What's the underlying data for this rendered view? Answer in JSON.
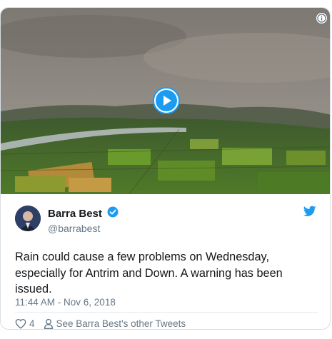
{
  "tweet": {
    "display_name": "Barra Best",
    "handle": "@barrabest",
    "text": "Rain could cause a few problems on Wednesday, especially for Antrim and Down.  A warning has been issued.",
    "timestamp": "11:44 AM - Nov 6, 2018",
    "like_count": "4",
    "other_tweets_label": "See Barra Best's other Tweets",
    "verified": true
  },
  "media": {
    "type": "video",
    "play_icon": "play-icon",
    "info_icon": "info-icon"
  },
  "icons": {
    "brand": "twitter-bird-icon",
    "verified": "verified-badge-icon",
    "like": "heart-icon",
    "profile": "person-icon"
  },
  "colors": {
    "accent": "#1d9bf0",
    "text": "#14171a",
    "muted": "#657786",
    "border": "#d8dee3"
  }
}
